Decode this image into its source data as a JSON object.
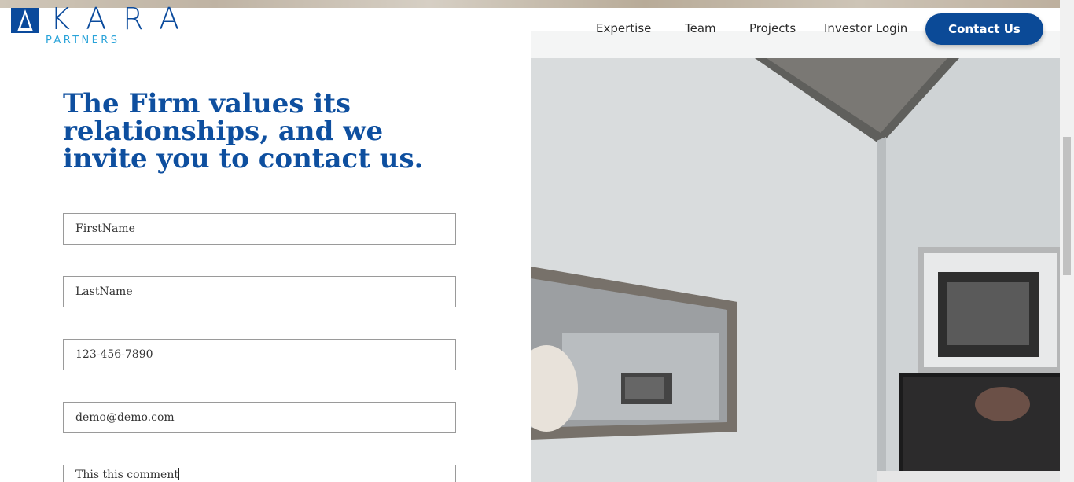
{
  "brand": {
    "logo_word": "KARA",
    "logo_sub": "PARTNERS",
    "primary_color": "#0b4a97",
    "accent_color": "#29a3d9"
  },
  "nav": {
    "items": [
      "Expertise",
      "Team",
      "Projects",
      "Investor Login"
    ],
    "cta_label": "Contact Us"
  },
  "contact": {
    "headline": "The Firm values its relationships, and we invite you to contact us.",
    "fields": {
      "first_name": "FirstName",
      "last_name": "LastName",
      "phone": "123-456-7890",
      "email": "demo@demo.com",
      "comment": "This this comment"
    }
  },
  "hero_image": {
    "icon": "interior-photo-living-room-mirror-tv"
  }
}
